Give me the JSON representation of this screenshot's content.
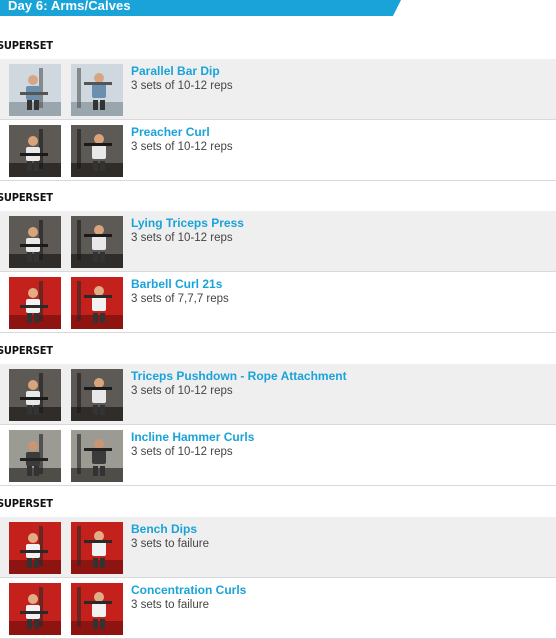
{
  "day": {
    "title": "Day 6: Arms/Calves"
  },
  "superset_label": "SUPERSET",
  "colors": {
    "accent": "#1aa3d9",
    "row_shade": "#efefef",
    "divider": "#d9d9d9"
  },
  "supersets": [
    {
      "exercises": [
        {
          "name": "Parallel Bar Dip",
          "sets": "3 sets of 10-12 reps",
          "scene": "gym-light"
        },
        {
          "name": "Preacher Curl",
          "sets": "3 sets of 10-12 reps",
          "scene": "gym-dark"
        }
      ]
    },
    {
      "exercises": [
        {
          "name": "Lying Triceps Press",
          "sets": "3 sets of 10-12 reps",
          "scene": "gym-dark"
        },
        {
          "name": "Barbell Curl 21s",
          "sets": "3 sets of 7,7,7 reps",
          "scene": "studio-red"
        }
      ]
    },
    {
      "exercises": [
        {
          "name": "Triceps Pushdown - Rope Attachment",
          "sets": "3 sets of 10-12 reps",
          "scene": "gym-dark"
        },
        {
          "name": "Incline Hammer Curls",
          "sets": "3 sets of 10-12 reps",
          "scene": "gym-grey"
        }
      ]
    },
    {
      "exercises": [
        {
          "name": "Bench Dips",
          "sets": "3 sets to failure",
          "scene": "studio-red"
        },
        {
          "name": "Concentration Curls",
          "sets": "3 sets to failure",
          "scene": "studio-red"
        }
      ]
    }
  ]
}
